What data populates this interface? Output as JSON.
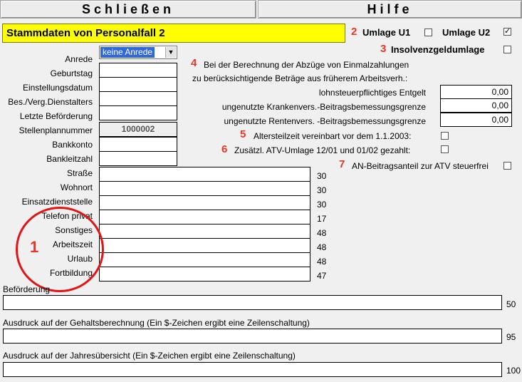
{
  "buttons": {
    "close": "Schließen",
    "help": "Hilfe"
  },
  "title": "Stammdaten von Personalfall 2",
  "badges": {
    "b1": "1",
    "b2": "2",
    "b3": "3",
    "b4": "4",
    "b5": "5",
    "b6": "6",
    "b7": "7"
  },
  "umlage": {
    "u1_label": "Umlage U1",
    "u1_checked": false,
    "u2_label": "Umlage U2",
    "u2_checked": true,
    "insolvenz_label": "Insolvenzgeldumlage",
    "insolvenz_checked": false
  },
  "anrede": {
    "label": "Anrede",
    "value": "keine Anrede"
  },
  "fields": [
    {
      "label": "Geburtstag",
      "value": ""
    },
    {
      "label": "Einstellungsdatum",
      "value": ""
    },
    {
      "label": "Bes./Verg.Dienstalters",
      "value": ""
    },
    {
      "label": "Letzte Beförderung",
      "value": ""
    },
    {
      "label": "Stellenplannummer",
      "value": "1000002"
    },
    {
      "label": "Bankkonto",
      "value": ""
    },
    {
      "label": "Bankleitzahl",
      "value": ""
    }
  ],
  "long_fields": [
    {
      "label": "Straße",
      "max": "30"
    },
    {
      "label": "Wohnort",
      "max": "30"
    },
    {
      "label": "Einsatzdienststelle",
      "max": "30"
    },
    {
      "label": "Telefon privat",
      "max": "17"
    },
    {
      "label": "Sonstiges",
      "max": "48"
    },
    {
      "label": "Arbeitszeit",
      "max": "48"
    },
    {
      "label": "Urlaub",
      "max": "48"
    },
    {
      "label": "Fortbildung",
      "max": "47"
    }
  ],
  "abzuege": {
    "heading1": "Bei der Berechnung der Abzüge von Einmalzahlungen",
    "heading2": "zu berücksichtigende Beträge aus früherem Arbeitsverh.:",
    "rows": [
      {
        "label": "lohnsteuerpflichtiges Entgelt",
        "value": "0,00"
      },
      {
        "label": "ungenutzte Krankenvers.-Beitragsbemessungsgrenze",
        "value": "0,00"
      },
      {
        "label": "ungenutzte Rentenvers. -Beitragsbemessungsgrenze",
        "value": "0,00"
      }
    ]
  },
  "checks": {
    "altersteilzeit": "Altersteilzeit vereinbart vor dem 1.1.2003:",
    "atv_umlage": "Zusätzl. ATV-Umlage 12/01 und 01/02 gezahlt:",
    "an_beitrag": "AN-Beitragsanteil zur ATV steuerfrei"
  },
  "bottom": [
    {
      "label": "Beförderung",
      "max": "50"
    },
    {
      "label": "Ausdruck auf der Gehaltsberechnung (Ein $-Zeichen ergibt eine Zeilenschaltung)",
      "max": "95"
    },
    {
      "label": "Ausdruck auf der Jahresübersicht (Ein $-Zeichen ergibt eine Zeilenschaltung)",
      "max": "100"
    }
  ]
}
